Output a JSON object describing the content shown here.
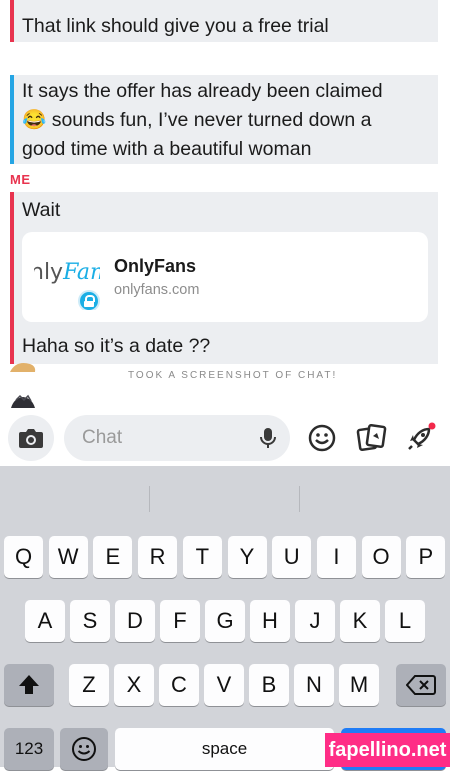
{
  "messages": [
    {
      "id": "m1",
      "side": "red",
      "lines": [
        "That link should give you a free trial"
      ]
    },
    {
      "id": "m2",
      "side": "blue",
      "lines": [
        "It says the offer has already been claimed",
        "😂 sounds fun, I’ve never turned down a",
        "good time with a beautiful woman"
      ]
    }
  ],
  "me_label": "ME",
  "me_msg_1": "Wait",
  "link_card": {
    "logo_word_left": "nly",
    "logo_word_right": "Fan",
    "title": "OnlyFans",
    "url": "onlyfans.com"
  },
  "me_msg_2": "Haha so it’s a date ??",
  "screenshot_note": "TOOK A SCREENSHOT OF CHAT!",
  "composer": {
    "placeholder": "Chat"
  },
  "keyboard": {
    "row1": [
      "Q",
      "W",
      "E",
      "R",
      "T",
      "Y",
      "U",
      "I",
      "O",
      "P"
    ],
    "row2": [
      "A",
      "S",
      "D",
      "F",
      "G",
      "H",
      "J",
      "K",
      "L"
    ],
    "row3": [
      "Z",
      "X",
      "C",
      "V",
      "B",
      "N",
      "M"
    ],
    "numbers_label": "123",
    "space_label": "space"
  },
  "watermark": "fapellino.net",
  "colors": {
    "me_accent": "#e8344f",
    "friend_accent": "#25a5e4",
    "link_blue": "#1aaee5"
  }
}
